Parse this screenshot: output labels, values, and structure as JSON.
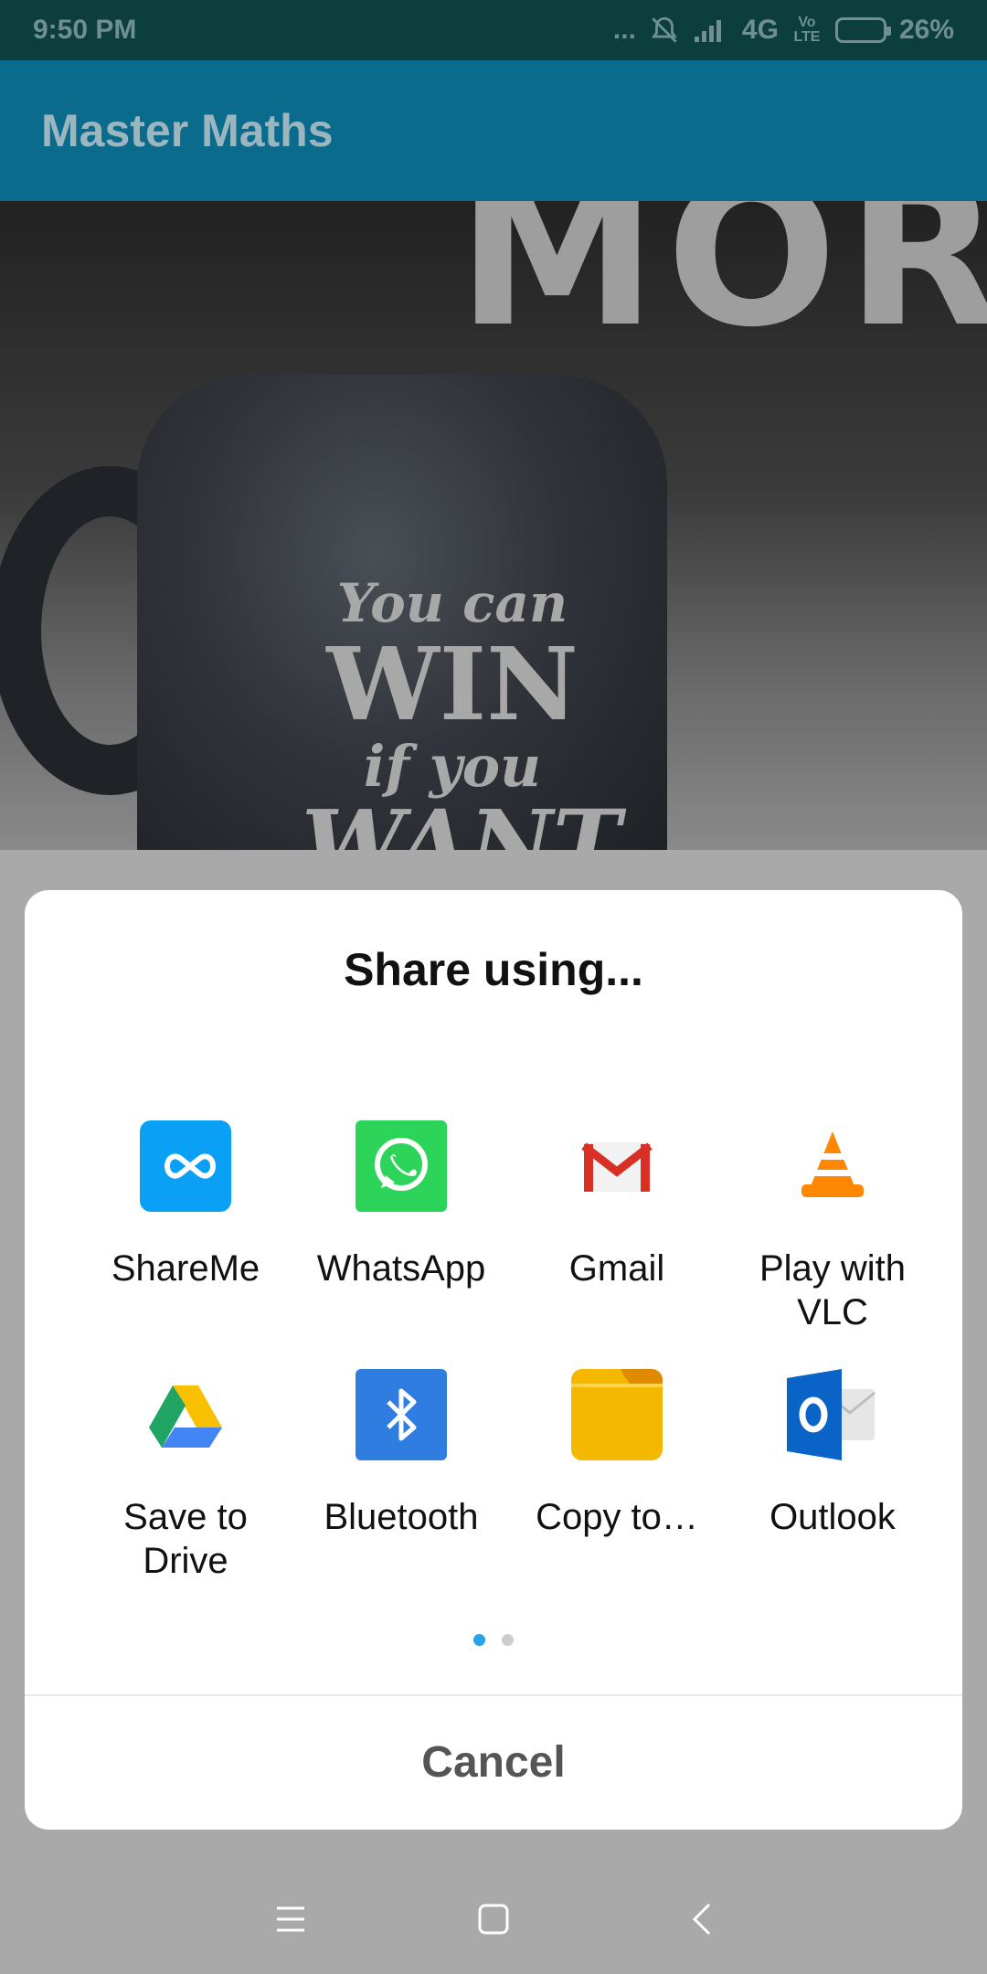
{
  "status_bar": {
    "time": "9:50 PM",
    "network_dots": "...",
    "network": "4G",
    "volte": "Vo LTE",
    "battery": "26%"
  },
  "app_bar": {
    "title": "Master Maths"
  },
  "hero": {
    "wall_text": "MORE",
    "mug_line1": "You can",
    "mug_line2": "WIN",
    "mug_line3": "if you",
    "mug_line4": "WANT"
  },
  "share_dialog": {
    "title": "Share using...",
    "apps": [
      {
        "label": "ShareMe",
        "icon": "shareme-icon",
        "color": "#0aa0f5"
      },
      {
        "label": "WhatsApp",
        "icon": "whatsapp-icon",
        "color": "#2cd45a"
      },
      {
        "label": "Gmail",
        "icon": "gmail-icon",
        "color": "#d93025"
      },
      {
        "label": "Play with VLC",
        "icon": "vlc-icon",
        "color": "#ff8800"
      },
      {
        "label": "Save to Drive",
        "icon": "drive-icon",
        "color": "#1fa463"
      },
      {
        "label": "Bluetooth",
        "icon": "bluetooth-icon",
        "color": "#2f7de1"
      },
      {
        "label": "Copy to…",
        "icon": "folder-icon",
        "color": "#f5b800"
      },
      {
        "label": "Outlook",
        "icon": "outlook-icon",
        "color": "#0a64c8"
      }
    ],
    "page_indicator": {
      "current": 1,
      "total": 2,
      "active_color": "#29a3e8",
      "inactive_color": "#cccccc"
    },
    "cancel_label": "Cancel"
  },
  "nav_bar": {
    "icons": [
      "menu-icon",
      "home-icon",
      "back-icon"
    ]
  }
}
